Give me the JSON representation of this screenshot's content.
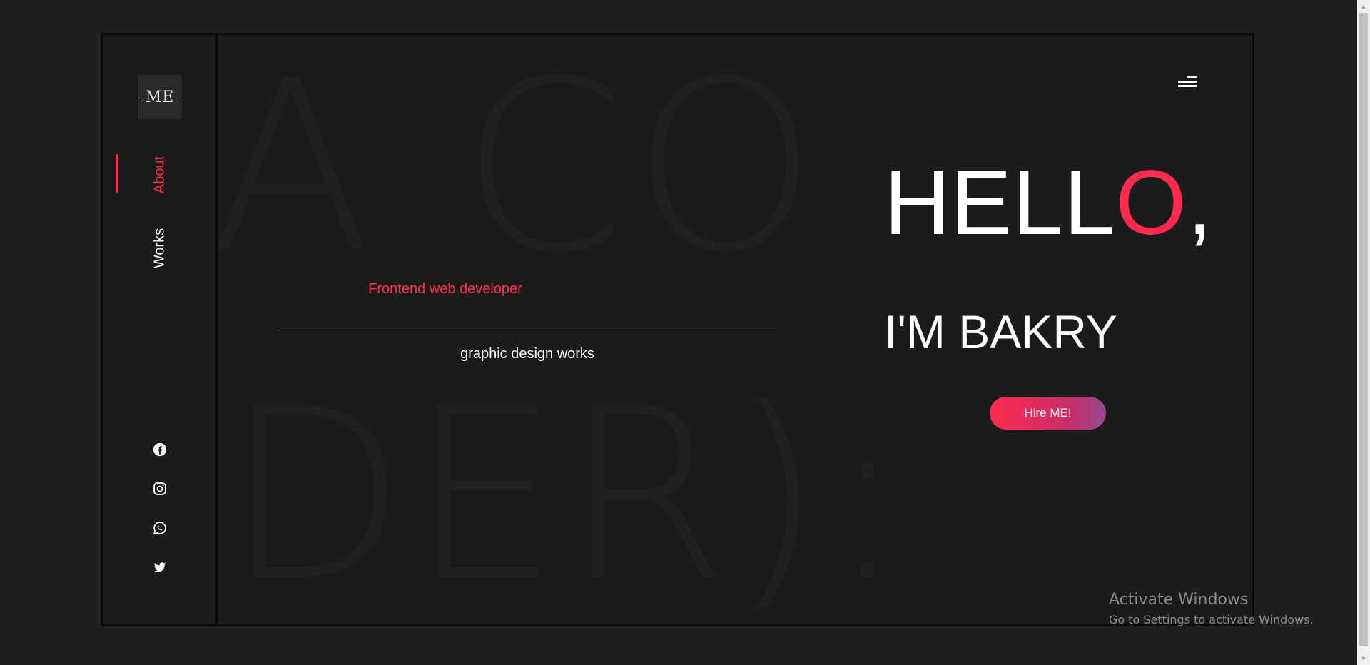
{
  "logo": {
    "text": "ME"
  },
  "nav": {
    "items": [
      {
        "label": "About",
        "active": true
      },
      {
        "label": "Works",
        "active": false
      }
    ]
  },
  "social": [
    "facebook-icon",
    "instagram-icon",
    "whatsapp-icon",
    "twitter-icon"
  ],
  "background_text": {
    "line1": "A CO",
    "line2": "DER):"
  },
  "hero": {
    "role": "Frontend web developer",
    "sub": "graphic design works",
    "hello_main": "HELL",
    "hello_accent": "O",
    "hello_end": ",",
    "name": "I'M BAKRY",
    "hire_label": "Hire ME!"
  },
  "colors": {
    "accent": "#ff2a4d",
    "background": "#1b1b1b",
    "page": "#1f1f1f"
  },
  "watermark": {
    "title": "Activate Windows",
    "subtitle": "Go to Settings to activate Windows."
  }
}
